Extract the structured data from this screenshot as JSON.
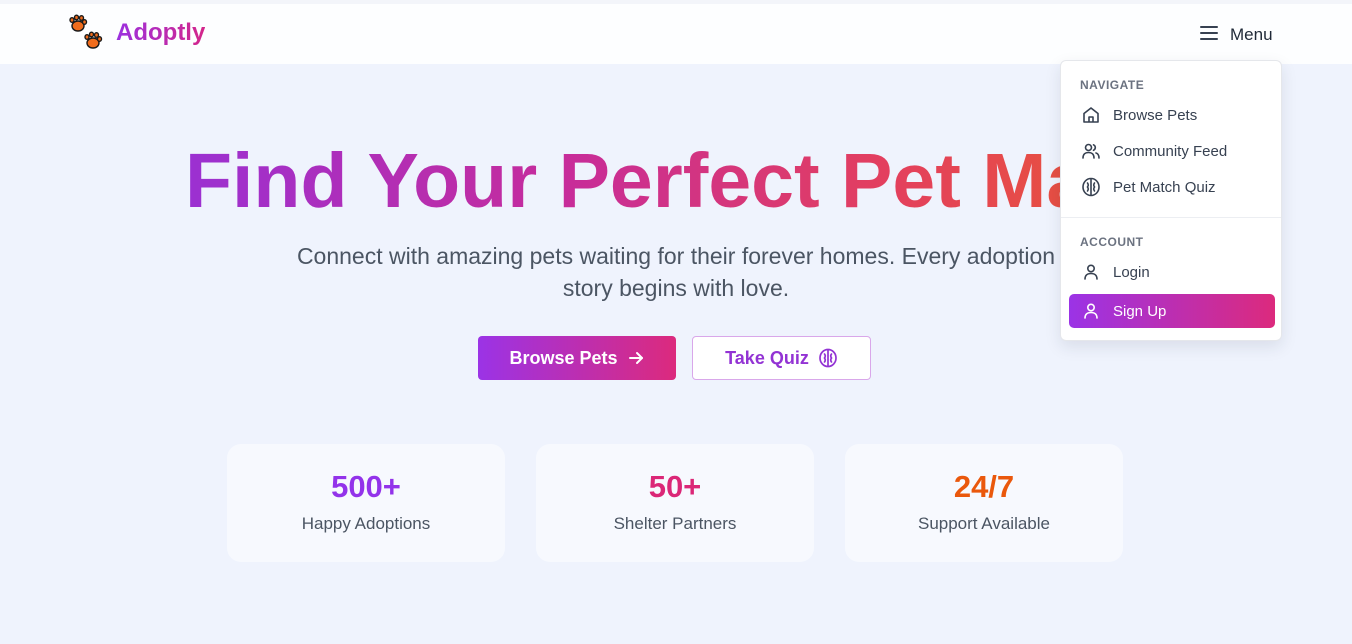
{
  "header": {
    "brand": "Adoptly",
    "menu_label": "Menu"
  },
  "hero": {
    "title": "Find Your Perfect Pet Match",
    "subtitle": "Connect with amazing pets waiting for their forever homes. Every adoption story begins with love.",
    "browse_label": "Browse Pets",
    "quiz_label": "Take Quiz"
  },
  "stats": [
    {
      "value": "500+",
      "label": "Happy Adoptions",
      "color": "#9333ea"
    },
    {
      "value": "50+",
      "label": "Shelter Partners",
      "color": "#db2777"
    },
    {
      "value": "24/7",
      "label": "Support Available",
      "color": "#ea580c"
    }
  ],
  "menu": {
    "navigate_heading": "NAVIGATE",
    "navigate_items": [
      {
        "label": "Browse Pets",
        "icon": "home-icon"
      },
      {
        "label": "Community Feed",
        "icon": "users-icon"
      },
      {
        "label": "Pet Match Quiz",
        "icon": "brain-icon"
      }
    ],
    "account_heading": "ACCOUNT",
    "account_items": [
      {
        "label": "Login",
        "icon": "user-icon"
      },
      {
        "label": "Sign Up",
        "icon": "user-icon",
        "active": true
      }
    ]
  },
  "colors": {
    "accent_start": "#9b33e6",
    "accent_end": "#dc2a7d"
  }
}
